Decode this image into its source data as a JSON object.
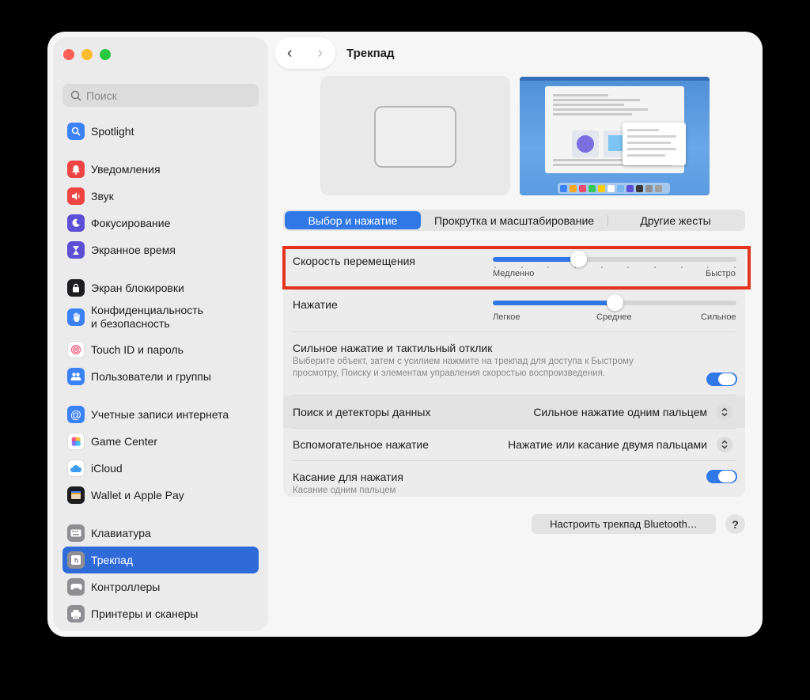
{
  "window": {
    "title": "Трекпад"
  },
  "search": {
    "placeholder": "Поиск"
  },
  "sidebar": {
    "items": [
      {
        "label": "Spotlight",
        "icon": "spotlight-icon",
        "color": "#3b82f6"
      },
      {
        "label": "Уведомления",
        "icon": "bell-icon",
        "color": "#ef4444"
      },
      {
        "label": "Звук",
        "icon": "speaker-icon",
        "color": "#ef4444"
      },
      {
        "label": "Фокусирование",
        "icon": "moon-icon",
        "color": "#5b4fd6"
      },
      {
        "label": "Экранное время",
        "icon": "hourglass-icon",
        "color": "#5b4fd6"
      },
      {
        "label": "Экран блокировки",
        "icon": "lock-icon",
        "color": "#1d1d1f"
      },
      {
        "label": "Конфиденциальность\nи безопасность",
        "icon": "hand-icon",
        "color": "#3b82f6"
      },
      {
        "label": "Touch ID и пароль",
        "icon": "fingerprint-icon",
        "color": "#ffffff"
      },
      {
        "label": "Пользователи и группы",
        "icon": "users-icon",
        "color": "#3b82f6"
      },
      {
        "label": "Учетные записи интернета",
        "icon": "at-icon",
        "color": "#3b82f6"
      },
      {
        "label": "Game Center",
        "icon": "game-center-icon",
        "color": "#ffffff"
      },
      {
        "label": "iCloud",
        "icon": "cloud-icon",
        "color": "#ffffff"
      },
      {
        "label": "Wallet и Apple Pay",
        "icon": "wallet-icon",
        "color": "#1d1d1f"
      },
      {
        "label": "Клавиатура",
        "icon": "keyboard-icon",
        "color": "#8e8e93"
      },
      {
        "label": "Трекпад",
        "icon": "trackpad-icon",
        "color": "#8e8e93"
      },
      {
        "label": "Контроллеры",
        "icon": "gamepad-icon",
        "color": "#8e8e93"
      },
      {
        "label": "Принтеры и сканеры",
        "icon": "printer-icon",
        "color": "#8e8e93"
      }
    ]
  },
  "tabs": [
    "Выбор и нажатие",
    "Прокрутка и масштабирование",
    "Другие жесты"
  ],
  "settings": {
    "speed": {
      "label": "Скорость перемещения",
      "min_label": "Медленно",
      "max_label": "Быстро",
      "value": 0.35
    },
    "click": {
      "label": "Нажатие",
      "labels": [
        "Легкое",
        "Среднее",
        "Сильное"
      ],
      "value": 0.5
    },
    "force": {
      "label": "Сильное нажатие и тактильный отклик",
      "description": "Выберите объект, затем с усилием нажмите на трекпад для доступа к Быстрому просмотру, Поиску и элементам управления скоростью воспроизведения.",
      "enabled": true
    },
    "lookup": {
      "label": "Поиск и детекторы данных",
      "value": "Сильное нажатие одним пальцем"
    },
    "secondary": {
      "label": "Вспомогательное нажатие",
      "value": "Нажатие или касание двумя пальцами"
    },
    "tap": {
      "label": "Касание для нажатия",
      "sublabel": "Касание одним пальцем",
      "enabled": true
    }
  },
  "bluetooth_button": "Настроить трекпад Bluetooth…",
  "help_button": "?",
  "accent_color": "#2f78e6"
}
